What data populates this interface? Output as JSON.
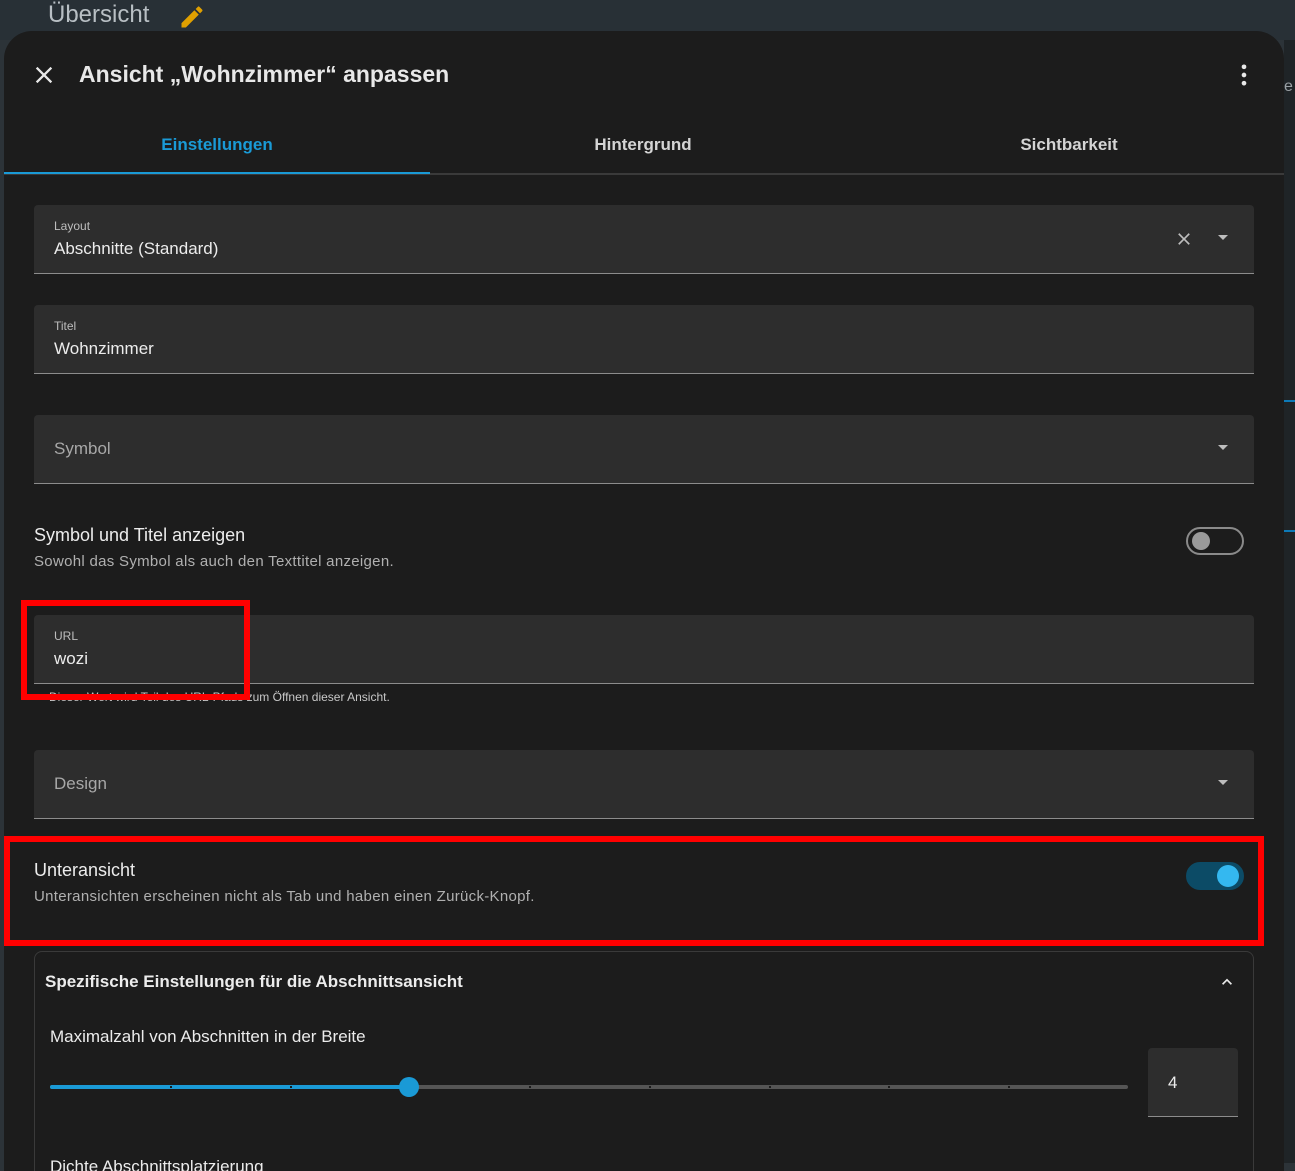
{
  "background": {
    "title": "Übersicht",
    "right_text": "e"
  },
  "dialog": {
    "title": "Ansicht „Wohnzimmer“ anpassen",
    "tabs": [
      {
        "label": "Einstellungen",
        "active": true
      },
      {
        "label": "Hintergrund",
        "active": false
      },
      {
        "label": "Sichtbarkeit",
        "active": false
      }
    ],
    "layout": {
      "label": "Layout",
      "value": "Abschnitte (Standard)"
    },
    "titel": {
      "label": "Titel",
      "value": "Wohnzimmer"
    },
    "symbol": {
      "placeholder": "Symbol"
    },
    "show_symbol_title": {
      "title": "Symbol und Titel anzeigen",
      "description": "Sowohl das Symbol als auch den Texttitel anzeigen.",
      "enabled": false
    },
    "url": {
      "label": "URL",
      "value": "wozi",
      "helper": "Dieser Wert wird Teil des URL-Pfads zum Öffnen dieser Ansicht."
    },
    "design": {
      "placeholder": "Design"
    },
    "subview": {
      "title": "Unteransicht",
      "description": "Unteransichten erscheinen nicht als Tab und haben einen Zurück-Knopf.",
      "enabled": true
    },
    "sections_settings": {
      "title": "Spezifische Einstellungen für die Abschnittsansicht",
      "max_columns_label": "Maximalzahl von Abschnitten in der Breite",
      "max_columns_value": "4",
      "slider_min": 1,
      "slider_max": 10,
      "slider_value": 4,
      "next_label": "Dichte Abschnittsplatzierung"
    }
  },
  "colors": {
    "accent": "#1a9ad6",
    "highlight": "#ff0000",
    "edit_icon": "#e0a000"
  }
}
